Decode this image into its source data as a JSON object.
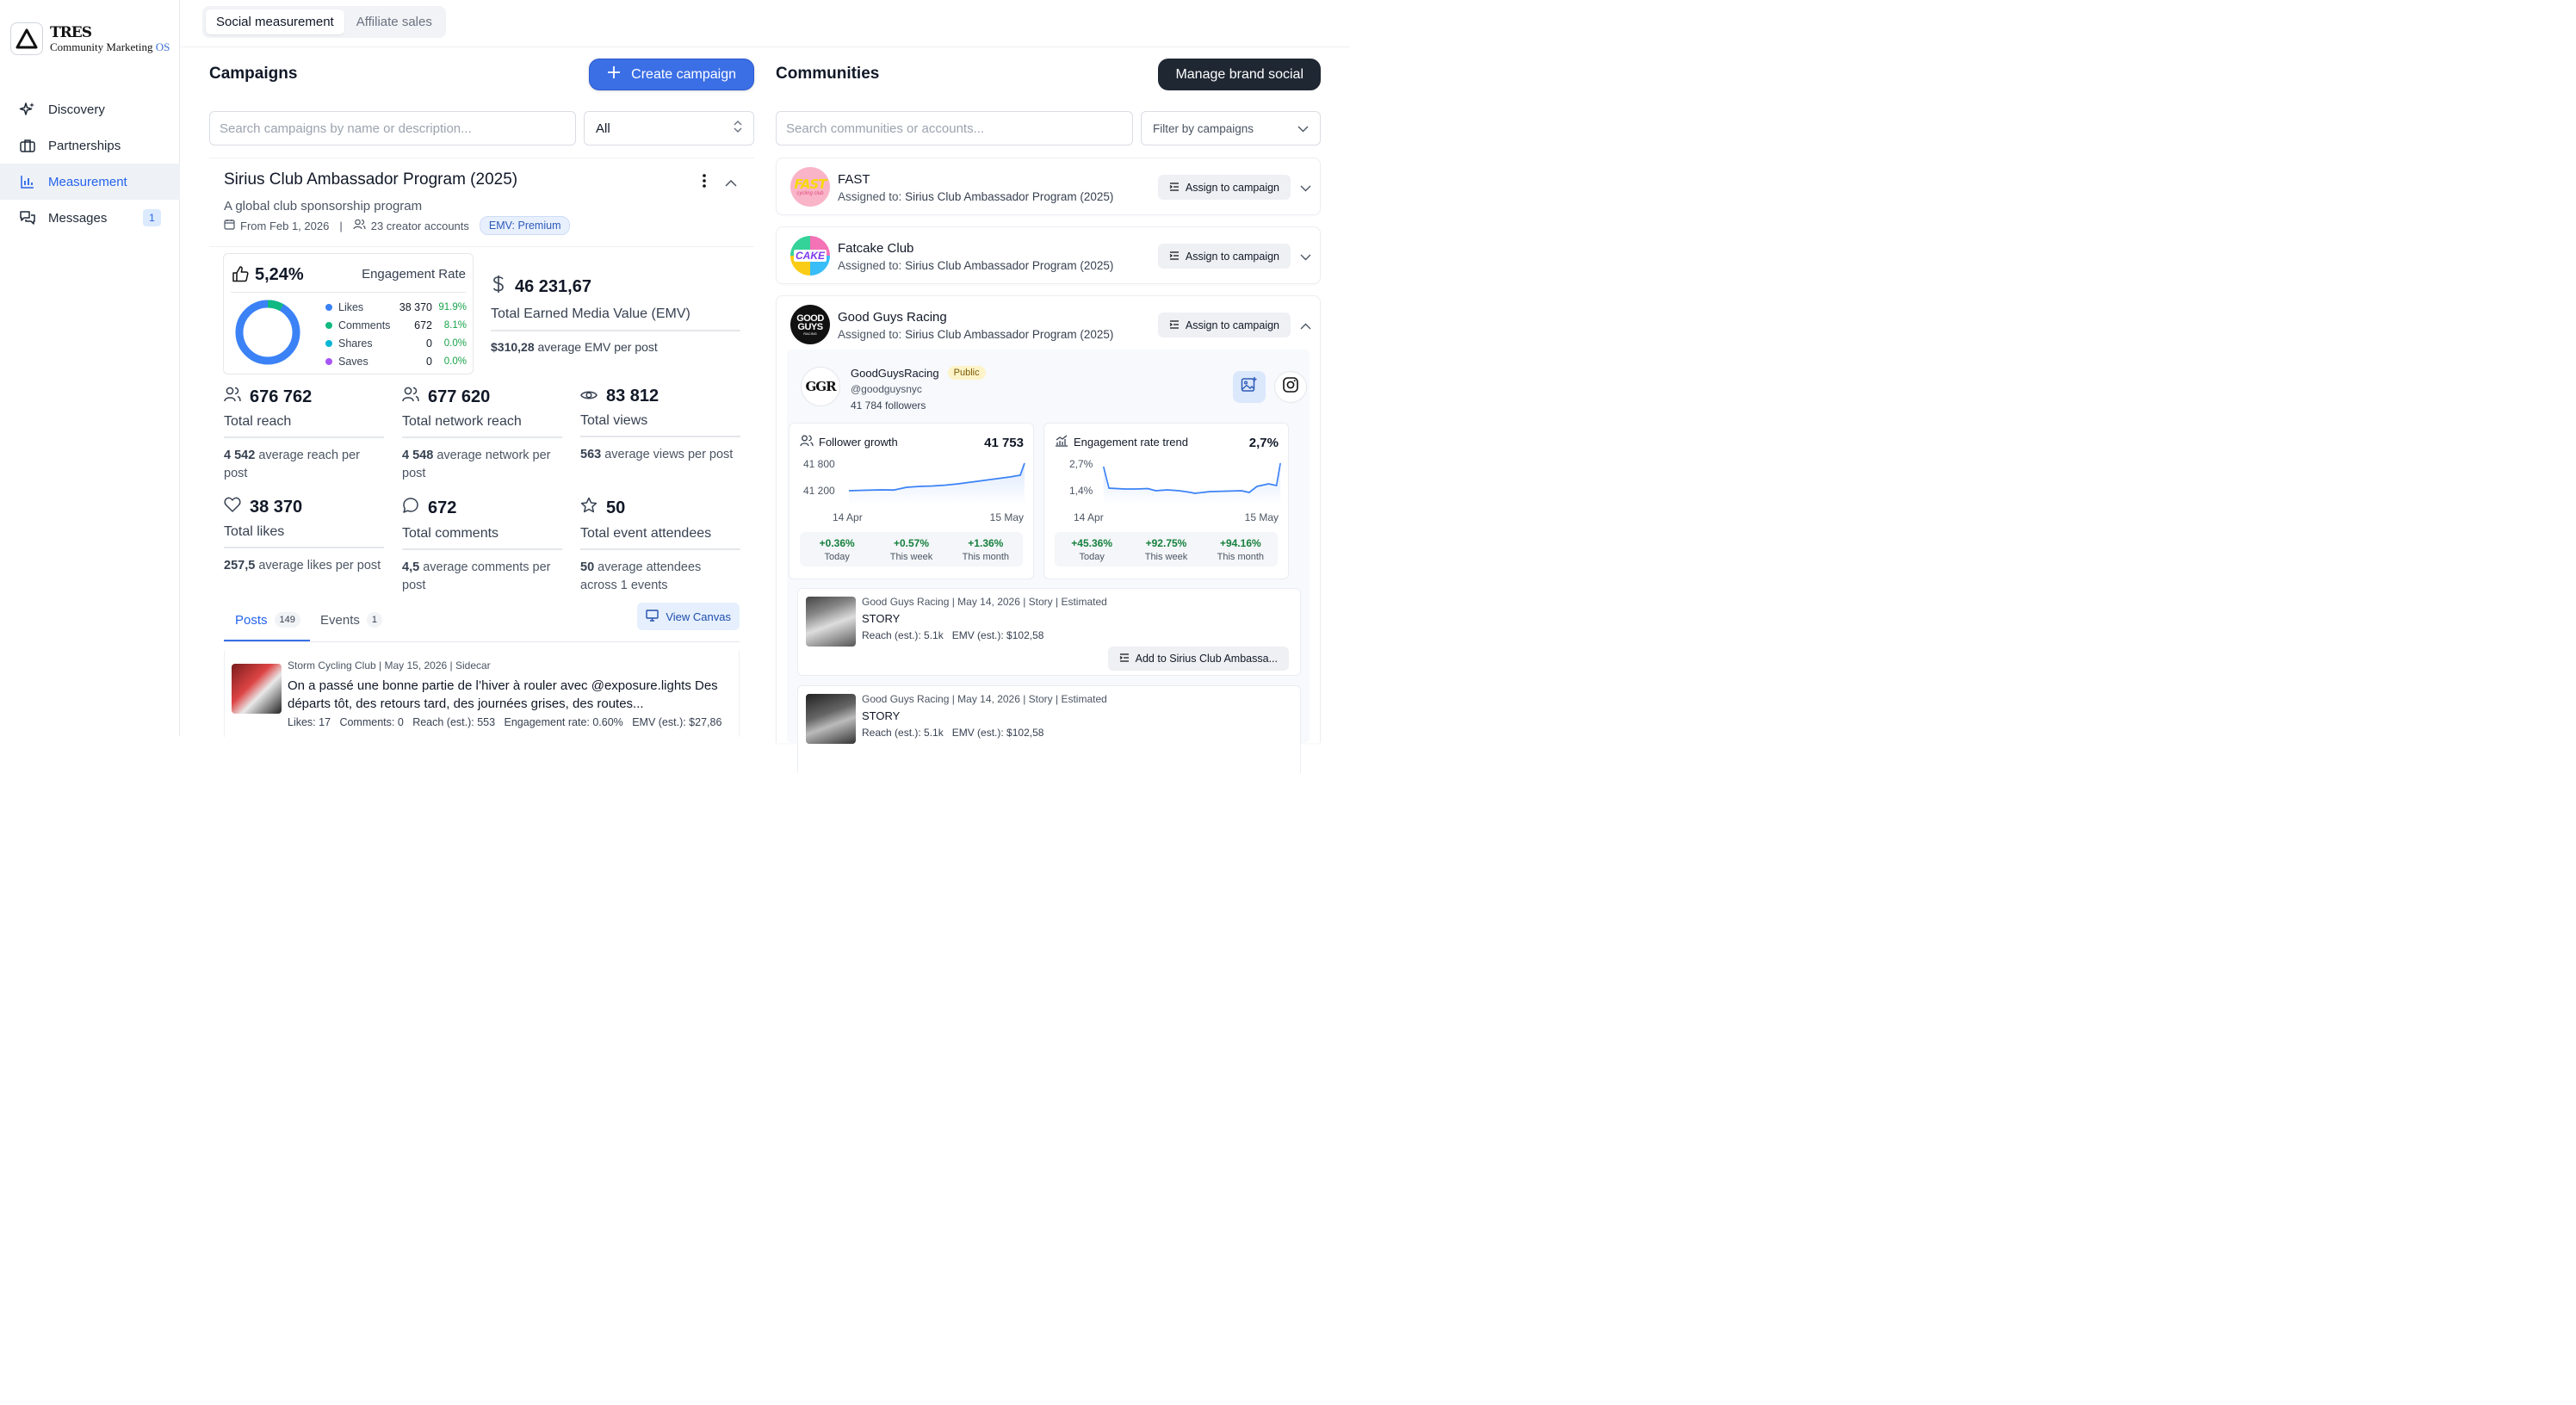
{
  "brand": {
    "name": "TRES",
    "sub": "Community Marketing",
    "os": "OS"
  },
  "sidebar": {
    "items": [
      {
        "label": "Discovery",
        "icon": "sparkles-icon"
      },
      {
        "label": "Partnerships",
        "icon": "briefcase-icon"
      },
      {
        "label": "Measurement",
        "icon": "bar-chart-icon",
        "active": true
      },
      {
        "label": "Messages",
        "icon": "chat-icon",
        "badge": "1"
      }
    ]
  },
  "topbar": {
    "tabs": [
      "Social measurement",
      "Affiliate sales"
    ]
  },
  "campaigns": {
    "title": "Campaigns",
    "create_label": "Create campaign",
    "search_placeholder": "Search campaigns by name or description...",
    "filter_value": "All",
    "card": {
      "title": "Sirius Club Ambassador Program (2025)",
      "description": "A global club sponsorship program",
      "from": "From Feb 1, 2026",
      "sep": "|",
      "creators": "23 creator accounts",
      "emv_badge": "EMV: Premium",
      "engagement": {
        "value": "5,24%",
        "label": "Engagement Rate",
        "rows": [
          {
            "name": "Likes",
            "count": "38 370",
            "pct": "91.9%",
            "color": "#3b82f6"
          },
          {
            "name": "Comments",
            "count": "672",
            "pct": "8.1%",
            "color": "#10b981"
          },
          {
            "name": "Shares",
            "count": "0",
            "pct": "0.0%",
            "color": "#06b6d4"
          },
          {
            "name": "Saves",
            "count": "0",
            "pct": "0.0%",
            "color": "#a855f7"
          }
        ]
      },
      "emv": {
        "value": "46 231,67",
        "label": "Total Earned Media Value (EMV)",
        "avg_value": "$310,28",
        "avg_text": "average EMV per post"
      },
      "stats": [
        {
          "value": "676 762",
          "label": "Total reach",
          "sub_value": "4 542",
          "sub_text": "average reach per post"
        },
        {
          "value": "677 620",
          "label": "Total network reach",
          "sub_value": "4 548",
          "sub_text": "average network per post"
        },
        {
          "value": "83 812",
          "label": "Total views",
          "sub_value": "563",
          "sub_text": "average views per post"
        },
        {
          "value": "38 370",
          "label": "Total likes",
          "sub_value": "257,5",
          "sub_text": "average likes per post"
        },
        {
          "value": "672",
          "label": "Total comments",
          "sub_value": "4,5",
          "sub_text": "average comments per post"
        },
        {
          "value": "50",
          "label": "Total event attendees",
          "sub_value": "50",
          "sub_text": "average attendees across 1 events"
        }
      ],
      "tabs": [
        {
          "label": "Posts",
          "count": "149"
        },
        {
          "label": "Events",
          "count": "1"
        }
      ],
      "view_canvas": "View Canvas",
      "post": {
        "meta": "Storm Cycling Club | May 15, 2026 | Sidecar",
        "text": "On a passé une bonne partie de l’hiver à rouler avec @exposure.lights Des départs tôt, des retours tard, des journées grises, des routes...",
        "stats": "Likes: 17   Comments: 0   Reach (est.): 553   Engagement rate: 0.60%   EMV (est.): $27,86"
      }
    }
  },
  "communities": {
    "title": "Communities",
    "manage_label": "Manage brand social",
    "search_placeholder": "Search communities or accounts...",
    "filter_placeholder": "Filter by campaigns",
    "assigned_prefix": "Assigned to:",
    "assign_label": "Assign to campaign",
    "items": [
      {
        "name": "FAST",
        "assigned": "Sirius Club Ambassador Program (2025)"
      },
      {
        "name": "Fatcake Club",
        "assigned": "Sirius Club Ambassador Program (2025)"
      },
      {
        "name": "Good Guys Racing",
        "assigned": "Sirius Club Ambassador Program (2025)"
      }
    ],
    "avatars": {
      "fast": "FAST",
      "fast_sub": "cycling club",
      "cake": "CAKE",
      "gg1": "GOOD",
      "gg2": "GUYS",
      "gg3": "RACING"
    },
    "account": {
      "logo": "GGR",
      "name": "GoodGuysRacing",
      "badge": "Public",
      "handle": "@goodguysnyc",
      "followers": "41 784 followers"
    },
    "follower_growth": {
      "title": "Follower growth",
      "value": "41 753",
      "y_labels": [
        "41 800",
        "41 200"
      ],
      "x_labels": [
        "14 Apr",
        "15 May"
      ],
      "stats": [
        {
          "v": "+0.36%",
          "l": "Today"
        },
        {
          "v": "+0.57%",
          "l": "This week"
        },
        {
          "v": "+1.36%",
          "l": "This month"
        }
      ]
    },
    "engagement_trend": {
      "title": "Engagement rate trend",
      "value": "2,7%",
      "y_labels": [
        "2,7%",
        "1,4%"
      ],
      "x_labels": [
        "14 Apr",
        "15 May"
      ],
      "stats": [
        {
          "v": "+45.36%",
          "l": "Today"
        },
        {
          "v": "+92.75%",
          "l": "This week"
        },
        {
          "v": "+94.16%",
          "l": "This month"
        }
      ]
    },
    "stories": [
      {
        "meta": "Good Guys Racing | May 14, 2026 | Story | Estimated",
        "title": "STORY",
        "stats": "Reach (est.): 5.1k   EMV (est.): $102,58",
        "add_label": "Add to Sirius Club Ambassa..."
      },
      {
        "meta": "Good Guys Racing | May 14, 2026 | Story | Estimated",
        "title": "STORY",
        "stats": "Reach (est.): 5.1k   EMV (est.): $102,58"
      }
    ]
  }
}
